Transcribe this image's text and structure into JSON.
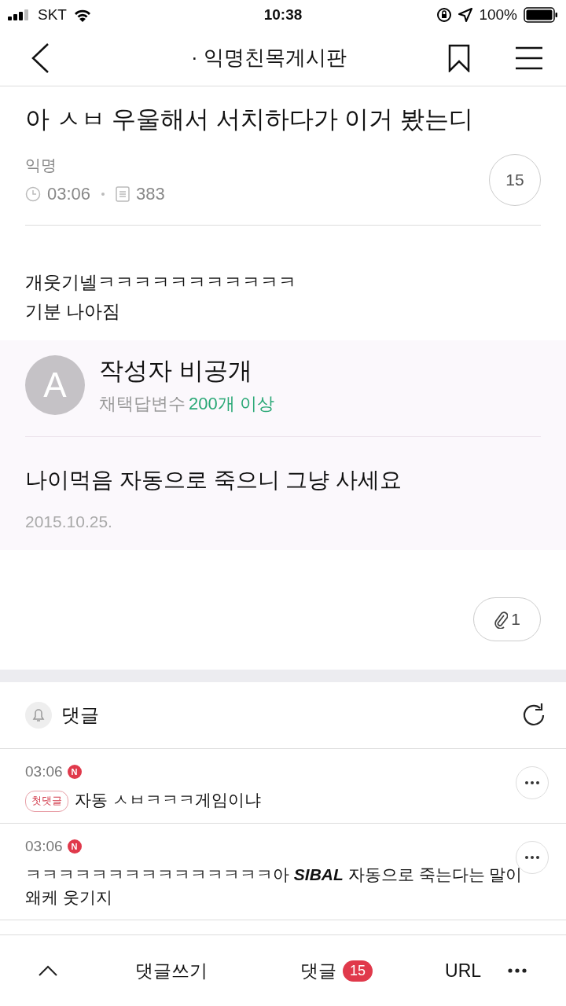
{
  "status_bar": {
    "carrier": "SKT",
    "time": "10:38",
    "battery": "100%"
  },
  "nav": {
    "title": "· 익명친목게시판"
  },
  "post": {
    "title": "아 ㅅㅂ 우울해서 서치하다가 이거 봤는디",
    "author": "익명",
    "time": "03:06",
    "views": "383",
    "comment_count": "15",
    "body": [
      "개웃기넬ㅋㅋㅋㅋㅋㅋㅋㅋㅋㅋㅋ",
      "기분 나아짐"
    ],
    "quoted_answer": {
      "avatar_letter": "A",
      "author": "작성자 비공개",
      "stat_label": "채택답변수",
      "stat_value": "200개 이상",
      "answer": "나이먹음 자동으로 죽으니 그냥 사세요",
      "date": "2015.10.25."
    },
    "attachment_count": "1"
  },
  "comments_header": {
    "label": "댓글"
  },
  "comments": [
    {
      "time": "03:06",
      "new_badge": "N",
      "first_comment_badge": "첫댓글",
      "text": "자동 ㅅㅂㅋㅋㅋ게임이냐"
    },
    {
      "time": "03:06",
      "new_badge": "N",
      "text": "ㅋㅋㅋㅋㅋㅋㅋㅋㅋㅋㅋㅋㅋㅋㅋ아 **SIBAL** 자동으로 죽는다는 말이 왜케 웃기지"
    }
  ],
  "bottom_bar": {
    "write": "댓글쓰기",
    "comments_label": "댓글",
    "comments_count": "15",
    "url": "URL"
  }
}
